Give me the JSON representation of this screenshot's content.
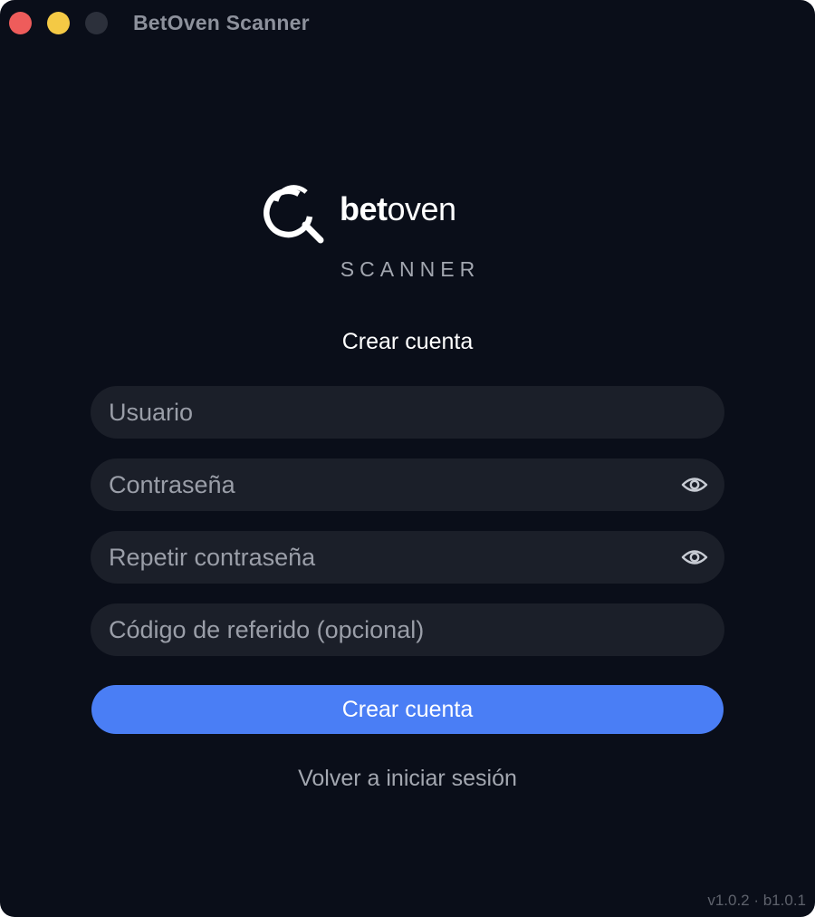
{
  "window": {
    "title": "BetOven Scanner"
  },
  "brand": {
    "word_bold": "bet",
    "word_regular": "oven",
    "subtitle": "SCANNER",
    "icon": "magnifier-logo-icon"
  },
  "form": {
    "heading": "Crear cuenta",
    "fields": {
      "username": {
        "placeholder": "Usuario",
        "value": ""
      },
      "password": {
        "placeholder": "Contraseña",
        "value": "",
        "toggle_icon": "eye-icon"
      },
      "repeat_password": {
        "placeholder": "Repetir contraseña",
        "value": "",
        "toggle_icon": "eye-icon"
      },
      "referral": {
        "placeholder": "Código de referido (opcional)",
        "value": ""
      }
    },
    "submit_label": "Crear cuenta",
    "back_link": "Volver a iniciar sesión"
  },
  "footer": {
    "version": "v1.0.2 · b1.0.1"
  },
  "colors": {
    "background": "#0a0e19",
    "field_background": "#1b1f29",
    "accent": "#4a7ef5",
    "close": "#ee5c5b",
    "minimize": "#f4c945",
    "maximize_disabled": "#2c303b"
  }
}
